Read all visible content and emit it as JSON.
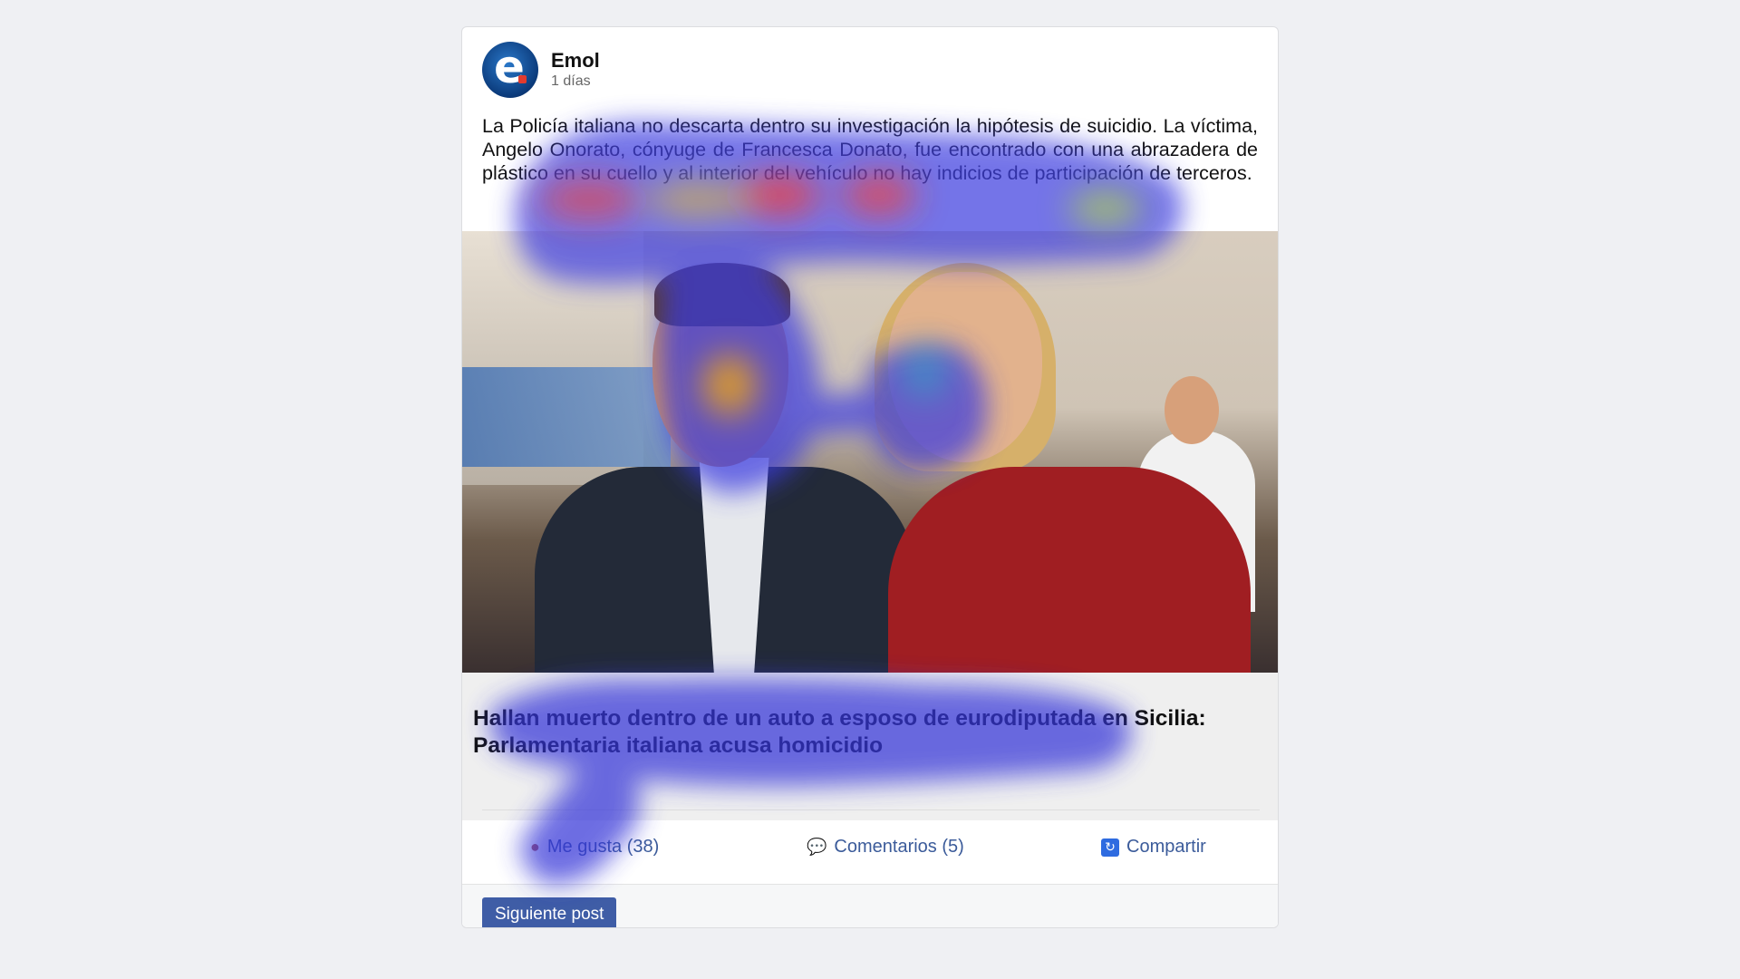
{
  "post": {
    "author": "Emol",
    "time": "1 días",
    "avatar_letter": "e",
    "text": "La Policía italiana no descarta dentro su investigación la hipótesis de suicidio. La víctima, Angelo Onorato, cónyuge de Francesca Donato, fue encontrado con una abrazadera de plástico en su cuello y al interior del vehículo no hay indicios de participación de terceros.",
    "headline": "Hallan muerto dentro de un auto a esposo de eurodiputada en Sicilia: Parlamentaria italiana acusa homicidio"
  },
  "actions": {
    "like_label": "Me gusta (38)",
    "comment_label": "Comentarios (5)",
    "share_label": "Compartir"
  },
  "footer": {
    "next_label": "Siguiente post"
  },
  "icons": {
    "like": "thumbs-up-icon",
    "comment": "speech-bubble-icon",
    "share": "repost-icon"
  },
  "colors": {
    "link": "#3b5b9a",
    "button": "#3f5da6",
    "share_icon": "#2e6be0"
  }
}
